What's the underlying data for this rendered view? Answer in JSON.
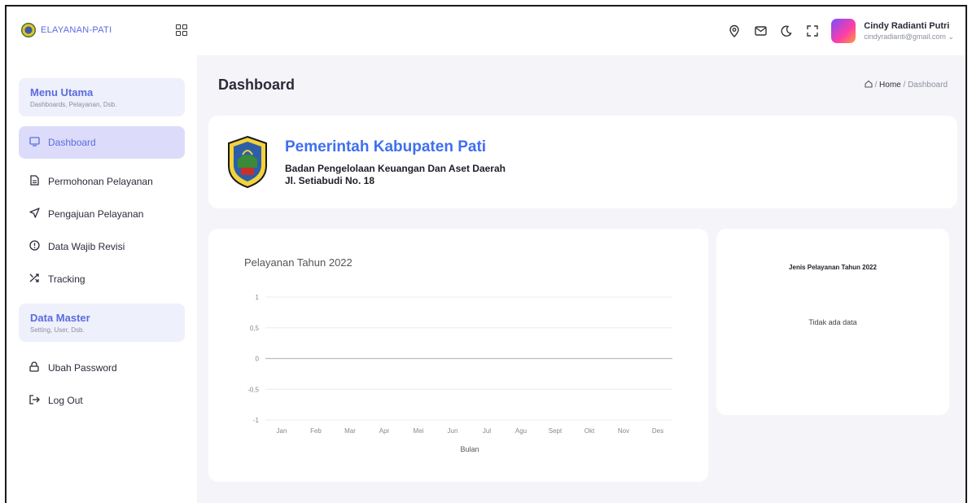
{
  "brand": {
    "name": "ELAYANAN-PATI"
  },
  "sidebar": {
    "section_main": {
      "title": "Menu Utama",
      "subtitle": "Dashboards, Pelayanan, Dsb."
    },
    "items_main": [
      {
        "label": "Dashboard",
        "icon": "monitor-icon"
      },
      {
        "label": "Permohonan Pelayanan",
        "icon": "document-icon"
      },
      {
        "label": "Pengajuan Pelayanan",
        "icon": "send-icon"
      },
      {
        "label": "Data Wajib Revisi",
        "icon": "alert-circle-icon"
      },
      {
        "label": "Tracking",
        "icon": "shuffle-icon"
      }
    ],
    "section_master": {
      "title": "Data Master",
      "subtitle": "Setting, User, Dsb."
    },
    "items_master": [
      {
        "label": "Ubah Password",
        "icon": "lock-icon"
      },
      {
        "label": "Log Out",
        "icon": "logout-icon"
      }
    ]
  },
  "topbar": {
    "user_name": "Cindy Radianti Putri",
    "user_email": "cindyradianti@gmail.com"
  },
  "page": {
    "title": "Dashboard",
    "breadcrumb_home": "Home",
    "breadcrumb_separator": "/",
    "breadcrumb_current": "Dashboard"
  },
  "org": {
    "title": "Pemerintah Kabupaten Pati",
    "line1": "Badan Pengelolaan Keuangan Dan Aset Daerah",
    "line2": "Jl. Setiabudi No. 18"
  },
  "pie": {
    "title": "Jenis Pelayanan Tahun 2022",
    "empty_text": "Tidak ada data"
  },
  "colors": {
    "accent": "#5b6be0",
    "active_bg": "#dcdcfa",
    "title_blue": "#3f6ff0"
  },
  "chart_data": {
    "type": "line",
    "title": "Pelayanan Tahun 2022",
    "xlabel": "Bulan",
    "ylabel": "",
    "categories": [
      "Jan",
      "Feb",
      "Mar",
      "Apr",
      "Mei",
      "Jun",
      "Jul",
      "Agu",
      "Sept",
      "Okt",
      "Nov",
      "Des"
    ],
    "y_ticks": [
      "1",
      "0,5",
      "0",
      "-0,5",
      "-1"
    ],
    "ylim": [
      -1,
      1
    ],
    "grid": true,
    "series": []
  }
}
